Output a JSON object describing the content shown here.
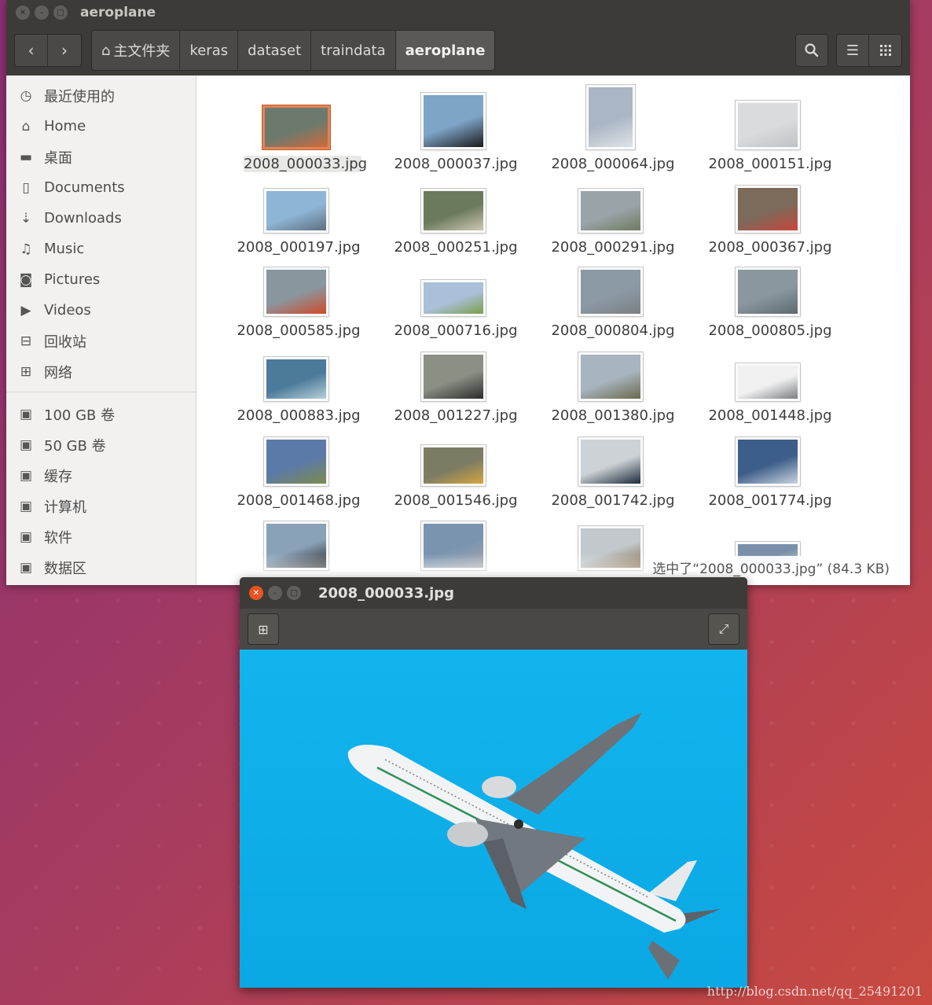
{
  "file_manager": {
    "window_title": "aeroplane",
    "breadcrumbs": [
      "主文件夹",
      "keras",
      "dataset",
      "traindata",
      "aeroplane"
    ],
    "sidebar": [
      {
        "label": "最近使用的",
        "icon": "clock-icon"
      },
      {
        "label": "Home",
        "icon": "home-icon"
      },
      {
        "label": "桌面",
        "icon": "folder-icon"
      },
      {
        "label": "Documents",
        "icon": "document-icon"
      },
      {
        "label": "Downloads",
        "icon": "download-icon"
      },
      {
        "label": "Music",
        "icon": "music-icon"
      },
      {
        "label": "Pictures",
        "icon": "camera-icon"
      },
      {
        "label": "Videos",
        "icon": "video-icon"
      },
      {
        "label": "回收站",
        "icon": "trash-icon"
      },
      {
        "label": "网络",
        "icon": "network-icon"
      }
    ],
    "devices": [
      {
        "label": "100 GB 卷",
        "icon": "drive-icon"
      },
      {
        "label": "50 GB 卷",
        "icon": "drive-icon"
      },
      {
        "label": "缓存",
        "icon": "drive-icon"
      },
      {
        "label": "计算机",
        "icon": "drive-icon"
      },
      {
        "label": "软件",
        "icon": "drive-icon"
      },
      {
        "label": "数据区",
        "icon": "drive-icon"
      }
    ],
    "files": [
      "2008_000033.jpg",
      "2008_000037.jpg",
      "2008_000064.jpg",
      "2008_000151.jpg",
      "2008_000197.jpg",
      "2008_000251.jpg",
      "2008_000291.jpg",
      "2008_000367.jpg",
      "2008_000585.jpg",
      "2008_000716.jpg",
      "2008_000804.jpg",
      "2008_000805.jpg",
      "2008_000883.jpg",
      "2008_001227.jpg",
      "2008_001380.jpg",
      "2008_001448.jpg",
      "2008_001468.jpg",
      "2008_001546.jpg",
      "2008_001742.jpg",
      "2008_001774.jpg"
    ],
    "selected_file": "2008_000033.jpg",
    "status": "选中了“2008_000033.jpg” (84.3 KB)"
  },
  "image_viewer": {
    "window_title": "2008_000033.jpg"
  },
  "watermark": "http://blog.csdn.net/qq_25491201"
}
